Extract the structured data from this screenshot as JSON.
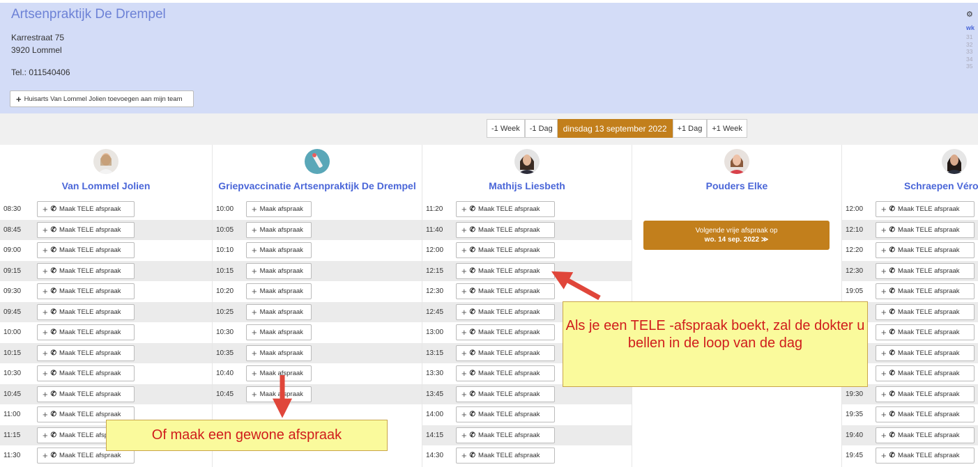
{
  "practice": {
    "name": "Artsenpraktijk De Drempel",
    "street": "Karrestraat 75",
    "city": "3920 Lommel",
    "phone": "Tel.: 011540406",
    "add_team_label": "Huisarts Van Lommel Jolien toevoegen aan mijn team"
  },
  "mini_calendar": {
    "header": "wk",
    "weeks": [
      "31",
      "32",
      "33",
      "34",
      "35"
    ]
  },
  "nav": {
    "minus_week": "-1 Week",
    "minus_day": "-1 Dag",
    "current_date": "dinsdag 13 september 2022",
    "plus_day": "+1 Dag",
    "plus_week": "+1 Week"
  },
  "columns": [
    {
      "name": "Van Lommel Jolien",
      "button_label": "Maak TELE afspraak",
      "times": [
        "08:30",
        "08:45",
        "09:00",
        "09:15",
        "09:30",
        "09:45",
        "10:00",
        "10:15",
        "10:30",
        "10:45",
        "11:00",
        "11:15",
        "11:30"
      ]
    },
    {
      "name": "Griepvaccinatie Artsenpraktijk De Drempel",
      "button_label": "Maak afspraak",
      "times": [
        "10:00",
        "10:05",
        "10:10",
        "10:15",
        "10:20",
        "10:25",
        "10:30",
        "10:35",
        "10:40",
        "10:45"
      ]
    },
    {
      "name": "Mathijs Liesbeth",
      "button_label": "Maak TELE afspraak",
      "times": [
        "11:20",
        "11:40",
        "12:00",
        "12:15",
        "12:30",
        "12:45",
        "13:00",
        "13:15",
        "13:30",
        "13:45",
        "14:00",
        "14:15",
        "14:30"
      ]
    },
    {
      "name": "Pouders Elke",
      "next_free_line1": "Volgende vrije afspraak op",
      "next_free_line2": "wo. 14 sep. 2022 ≫"
    },
    {
      "name": "Schraepen Véroni",
      "button_label": "Maak TELE afspraak",
      "times": [
        "12:00",
        "12:10",
        "12:20",
        "12:30",
        "19:05",
        "",
        "",
        "",
        "",
        "19:30",
        "19:35",
        "19:40",
        "19:45"
      ]
    }
  ],
  "annotations": {
    "tele_callout": "Als je een TELE -afspraak boekt, zal de dokter u bellen in de loop van de dag",
    "regular_callout": "Of maak een gewone afspraak"
  },
  "colors": {
    "header_bg": "#d3dcf7",
    "accent": "#c27f1c",
    "doctor_name": "#4a66d8",
    "arrow": "#e0463a"
  }
}
